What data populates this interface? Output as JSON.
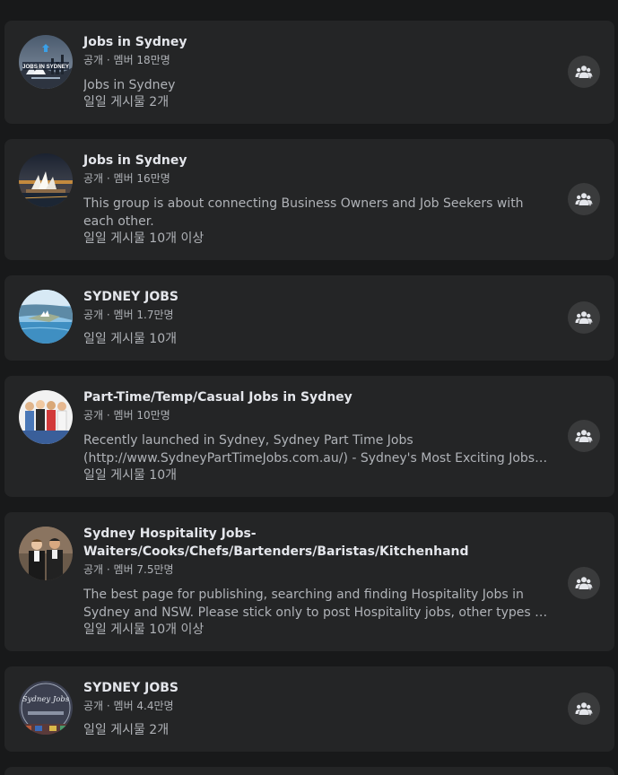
{
  "groups": [
    {
      "name": "Jobs in Sydney",
      "meta": "공개 · 멤버 18만명",
      "description": "Jobs in Sydney",
      "posts": "일일 게시물 2개",
      "avatar_text": "JOBS IN SYDNEY",
      "avatar_icon": "sydney-skyline-logo"
    },
    {
      "name": "Jobs in Sydney",
      "meta": "공개 · 멤버 16만명",
      "description": "This group is about connecting Business Owners and Job Seekers with each other.",
      "posts": "일일 게시물 10개 이상",
      "avatar_icon": "opera-house-night-photo"
    },
    {
      "name": "SYDNEY JOBS",
      "meta": "공개 · 멤버 1.7만명",
      "posts": "일일 게시물 10개",
      "avatar_icon": "harbour-aerial-photo"
    },
    {
      "name": "Part-Time/Temp/Casual Jobs in Sydney",
      "meta": "공개 · 멤버 10만명",
      "description": "Recently launched in Sydney, Sydney Part Time Jobs (http://www.SydneyPartTimeJobs.com.au/) - Sydney's Most Exciting Jobs Portal...",
      "posts": "일일 게시물 10개",
      "avatar_icon": "workers-group-photo"
    },
    {
      "name": "Sydney Hospitality Jobs-Waiters/Cooks/Chefs/Bartenders/Baristas/Kitchenhand",
      "meta": "공개 · 멤버 7.5만명",
      "description": "The best page for publishing, searching and finding Hospitality Jobs in Sydney and NSW. Please stick only to post Hospitality jobs, other types will be banned...",
      "posts": "일일 게시물 10개 이상",
      "avatar_icon": "hospitality-staff-photo"
    },
    {
      "name": "SYDNEY JOBS",
      "meta": "공개 · 멤버 4.4만명",
      "posts": "일일 게시물 2개",
      "avatar_text": "Sydney Jobs",
      "avatar_icon": "sydney-jobs-badge"
    }
  ],
  "join_icon": "group-join-icon",
  "colors": {
    "page_bg": "#18191a",
    "card_bg": "#242526",
    "button_bg": "#3a3b3c",
    "primary_text": "#e4e6eb",
    "secondary_text": "#b0b3b8"
  }
}
